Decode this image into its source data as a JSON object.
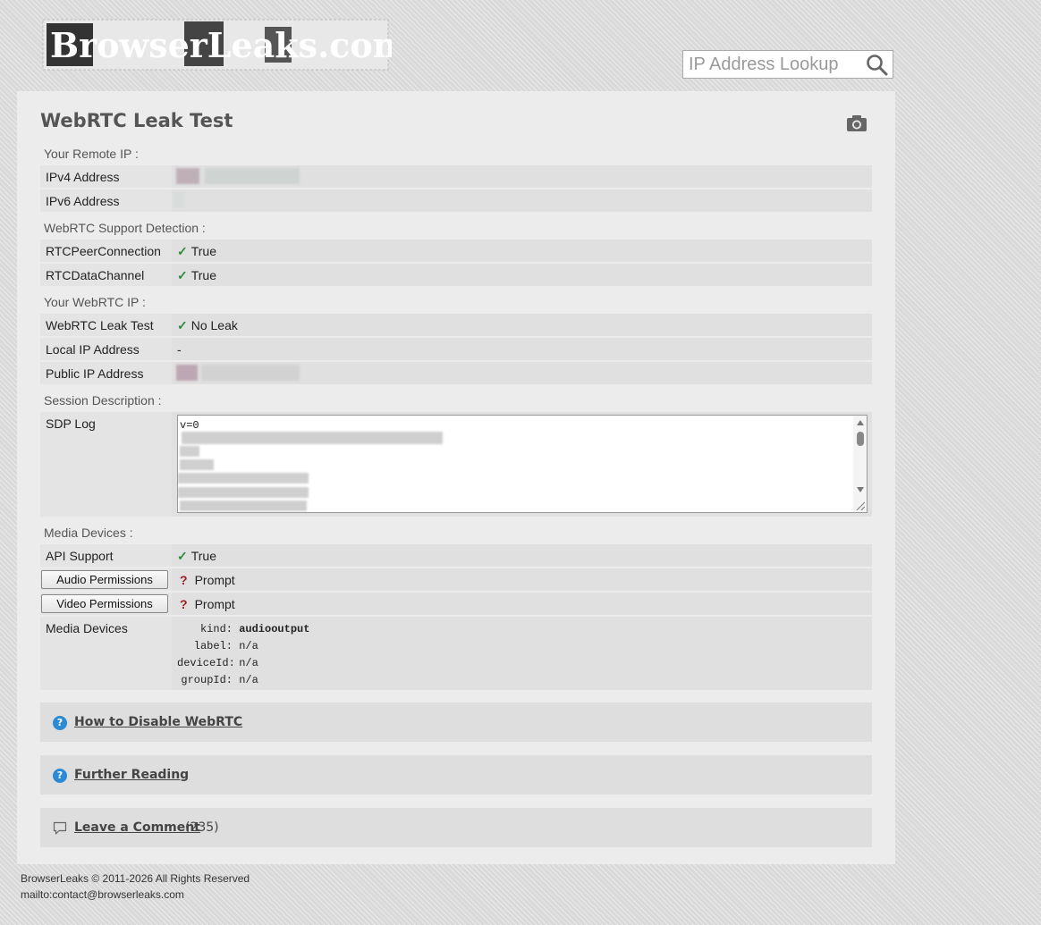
{
  "header": {
    "logo_text": "BrowserLeaks.com",
    "search_placeholder": "IP Address Lookup"
  },
  "page": {
    "title": "WebRTC Leak Test"
  },
  "remote_ip": {
    "section": "Your Remote IP :",
    "ipv4_label": "IPv4 Address",
    "ipv6_label": "IPv6 Address"
  },
  "support": {
    "section": "WebRTC Support Detection :",
    "rows": [
      {
        "label": "RTCPeerConnection",
        "value": "True"
      },
      {
        "label": "RTCDataChannel",
        "value": "True"
      }
    ]
  },
  "webrtc_ip": {
    "section": "Your WebRTC IP :",
    "leak_label": "WebRTC Leak Test",
    "leak_value": "No Leak",
    "local_label": "Local IP Address",
    "local_value": "-",
    "public_label": "Public IP Address"
  },
  "session": {
    "section": "Session Description :",
    "sdp_label": "SDP Log",
    "sdp_first_line": "v=0"
  },
  "media": {
    "section": "Media Devices :",
    "api_label": "API Support",
    "api_value": "True",
    "audio_button": "Audio Permissions",
    "audio_value": "Prompt",
    "video_button": "Video Permissions",
    "video_value": "Prompt",
    "devices_label": "Media Devices",
    "device": {
      "kind_key": "kind:",
      "kind_value": "audiooutput",
      "label_key": "label:",
      "label_value": "n/a",
      "deviceid_key": "deviceId:",
      "deviceid_value": "n/a",
      "groupid_key": "groupId:",
      "groupid_value": "n/a"
    }
  },
  "sections": {
    "disable": "How to Disable WebRTC",
    "reading": "Further Reading",
    "comment": "Leave a Comment",
    "comment_count": "(235)"
  },
  "footer": {
    "copyright": "BrowserLeaks © 2011-2026 All Rights Reserved",
    "mail": "mailto:contact@browserleaks.com"
  },
  "colors": {
    "check": "#2e8b3a",
    "question": "#9b1c1c",
    "info_icon": "#2a8ad6"
  }
}
